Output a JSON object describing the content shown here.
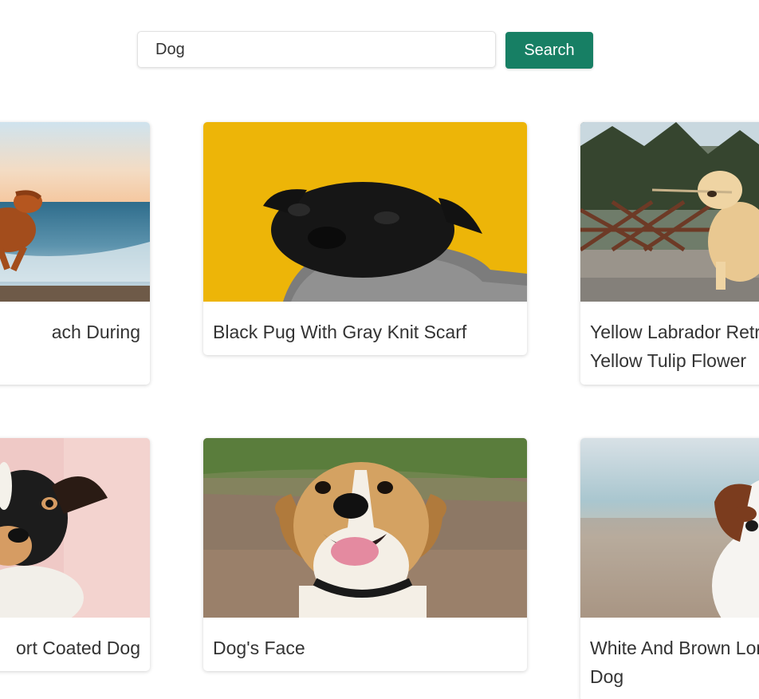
{
  "search": {
    "value": "Dog",
    "button_label": "Search"
  },
  "colors": {
    "accent": "#177f64"
  },
  "results": [
    {
      "caption_lines": [
        "ach During",
        ""
      ],
      "image": "dog-on-beach-photo"
    },
    {
      "caption_lines": [
        "Black Pug With Gray Knit Scarf"
      ],
      "image": "black-pug-photo"
    },
    {
      "caption_lines": [
        "Yellow Labrador Retri",
        "Yellow Tulip Flower"
      ],
      "image": "yellow-labrador-photo"
    },
    {
      "caption_lines": [
        "ort Coated Dog"
      ],
      "image": "short-coated-dog-photo"
    },
    {
      "caption_lines": [
        "Dog's Face"
      ],
      "image": "beagle-face-photo"
    },
    {
      "caption_lines": [
        "White And Brown Lon",
        "Dog"
      ],
      "image": "white-brown-dog-photo"
    }
  ]
}
